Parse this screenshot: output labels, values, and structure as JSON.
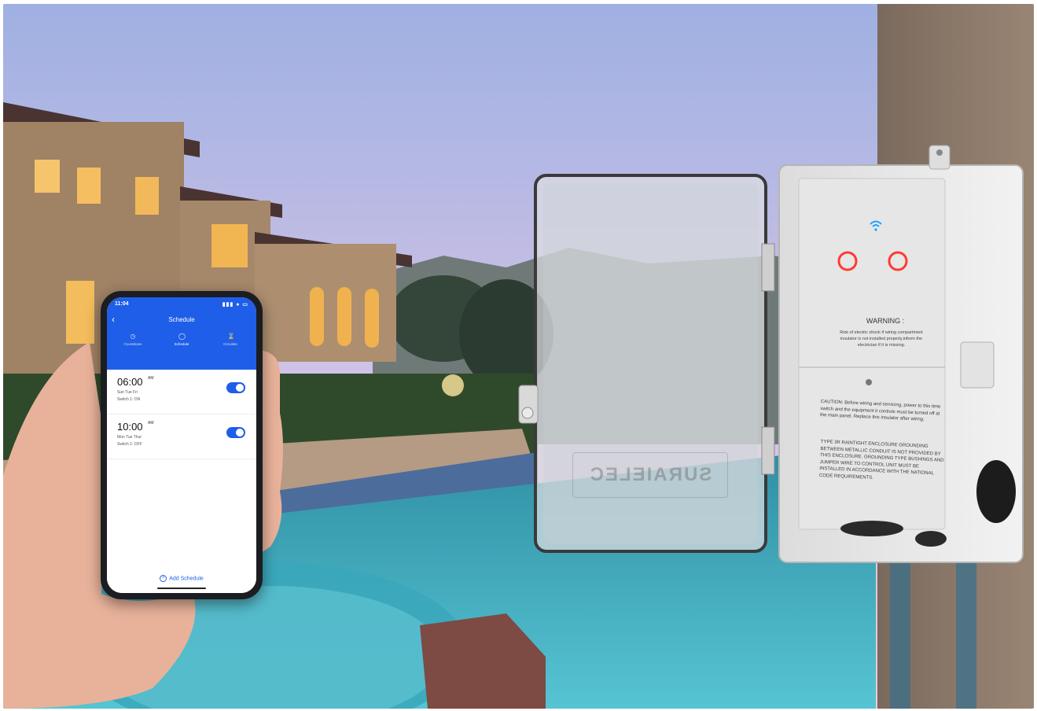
{
  "phone": {
    "status_time": "11:04",
    "status_icons": "▮▮▮ ● ▭",
    "back_icon": "chevron-left-icon",
    "title": "Schedule",
    "tabs": [
      {
        "label": "Countdown",
        "icon": "clock-icon"
      },
      {
        "label": "Schedule",
        "icon": "alarm-icon"
      },
      {
        "label": "Circulate",
        "icon": "hourglass-icon"
      }
    ],
    "schedules": [
      {
        "time": "06:00",
        "ampm": "AM",
        "days": "Sun Tue Fri",
        "action": "Switch 1: ON",
        "enabled": true
      },
      {
        "time": "10:00",
        "ampm": "AM",
        "days": "Mon Tue Thur",
        "action": "Switch 1: OFF",
        "enabled": true
      }
    ],
    "add_label": "Add Schedule",
    "accent": "#1f5ee8"
  },
  "enclosure": {
    "warning_title": "WARNING :",
    "warning_body": "Risk of electric shock if wiring compartment insulator is not installed properly,inform the electrician if it is missing.",
    "caution": "CAUTION: Before wiring and servicing, power to this time switch and the equipment it controls must be turned off at the main panel. Replace this insulator after wiring.",
    "type3r": "TYPE 3R RAINTIGHT ENCLOSURE GROUNDING BETWEEN METALLIC CONDUIT IS NOT PROVIDED BY THIS ENCLOSURE. GROUNDING TYPE BUSHINGS AND JUMPER WIRE TO CONTROL UNIT MUST BE INSTALLED IN ACCORDANCE WITH THE NATIONAL CODE REQUIREMENTS.",
    "brand": "SURAIELEC",
    "led_color": "#ff3b2f",
    "wifi_color": "#1aa3ff"
  }
}
